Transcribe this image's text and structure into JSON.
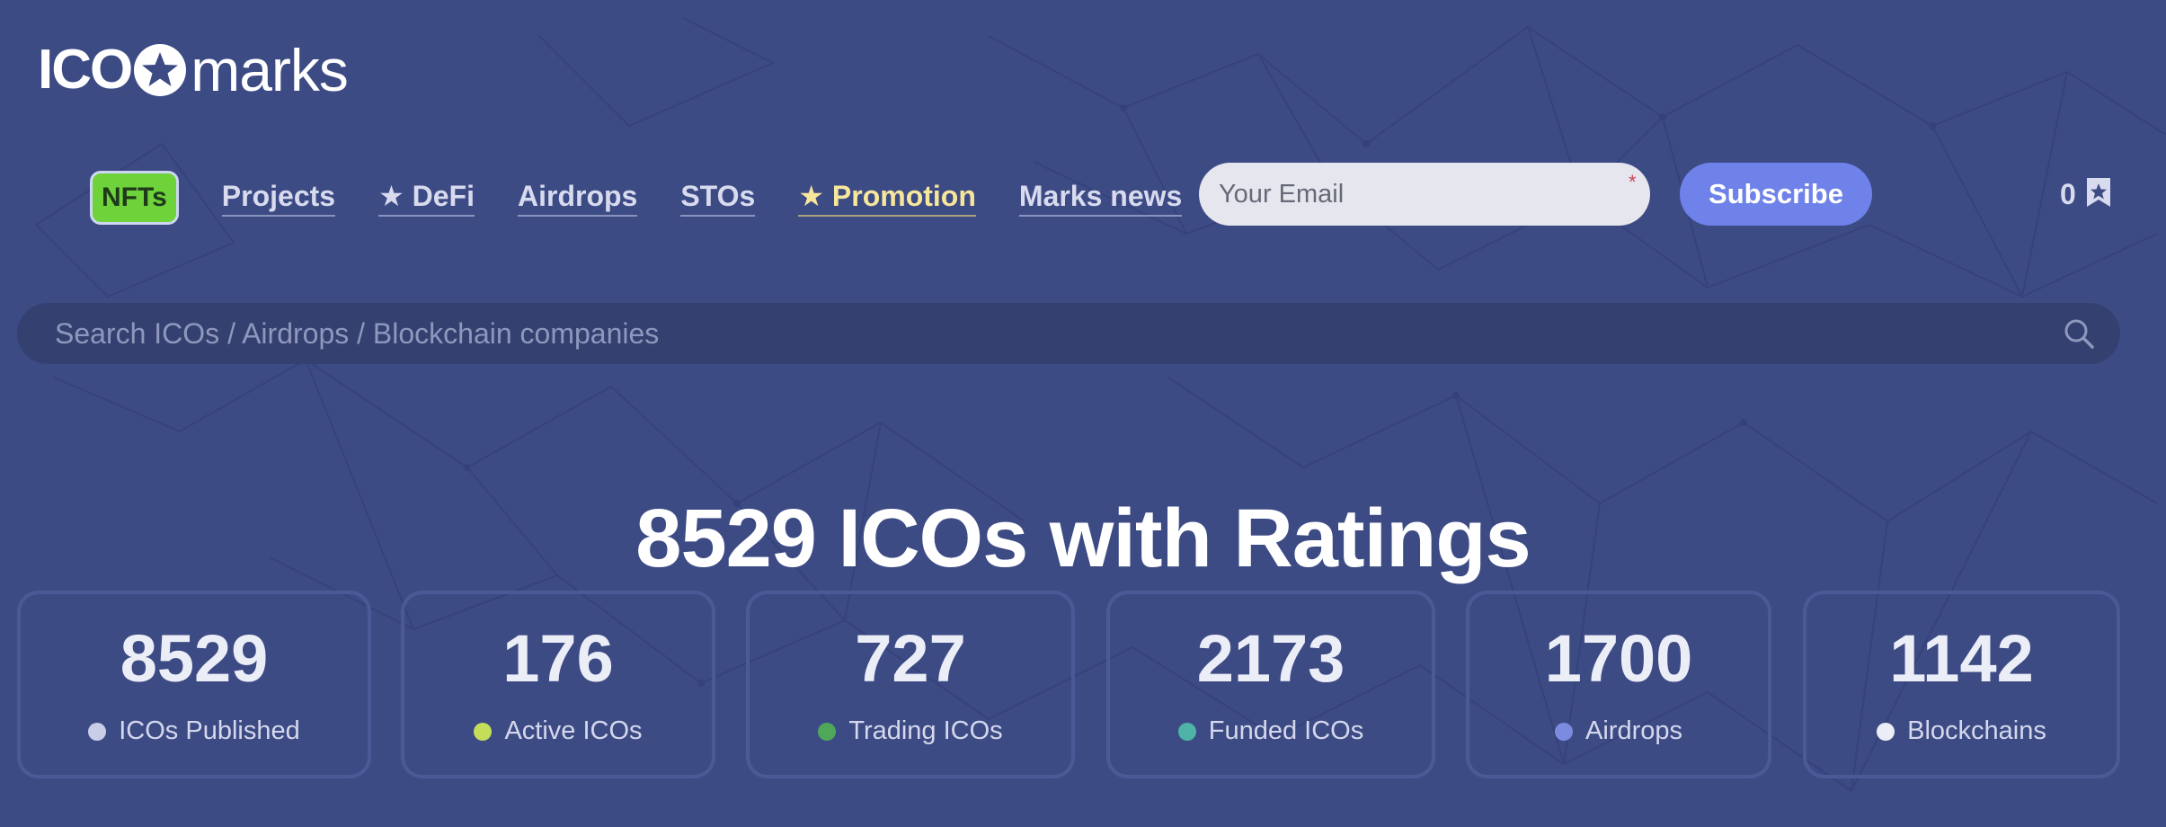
{
  "brand": {
    "logo_ico": "ICO",
    "logo_marks": "marks"
  },
  "nav": {
    "items": [
      {
        "label": "NFTs",
        "style": "badge",
        "color": "#6ed23a"
      },
      {
        "label": "Projects"
      },
      {
        "label": "DeFi",
        "star": true
      },
      {
        "label": "Airdrops"
      },
      {
        "label": "STOs"
      },
      {
        "label": "Promotion",
        "star": true,
        "color": "#f7e79a"
      },
      {
        "label": "Marks news"
      }
    ]
  },
  "subscribe": {
    "email_placeholder": "Your Email",
    "required_marker": "*",
    "button_label": "Subscribe"
  },
  "cart": {
    "count": "0",
    "icon": "star-badge-icon"
  },
  "search": {
    "placeholder": "Search ICOs / Airdrops / Blockchain companies",
    "icon": "search-icon"
  },
  "headline": "8529 ICOs with Ratings",
  "stats": [
    {
      "value": "8529",
      "label": "ICOs Published",
      "dot_color": "#c9cde8"
    },
    {
      "value": "176",
      "label": "Active ICOs",
      "dot_color": "#c5de5a"
    },
    {
      "value": "727",
      "label": "Trading ICOs",
      "dot_color": "#4fa85a"
    },
    {
      "value": "2173",
      "label": "Funded ICOs",
      "dot_color": "#4fb3a8"
    },
    {
      "value": "1700",
      "label": "Airdrops",
      "dot_color": "#7b8be0"
    },
    {
      "value": "1142",
      "label": "Blockchains",
      "dot_color": "#eceef7"
    }
  ],
  "colors": {
    "background": "#3d4b85",
    "accent": "#6f82ea",
    "promo": "#f7e79a",
    "nft_badge": "#6ed23a"
  }
}
